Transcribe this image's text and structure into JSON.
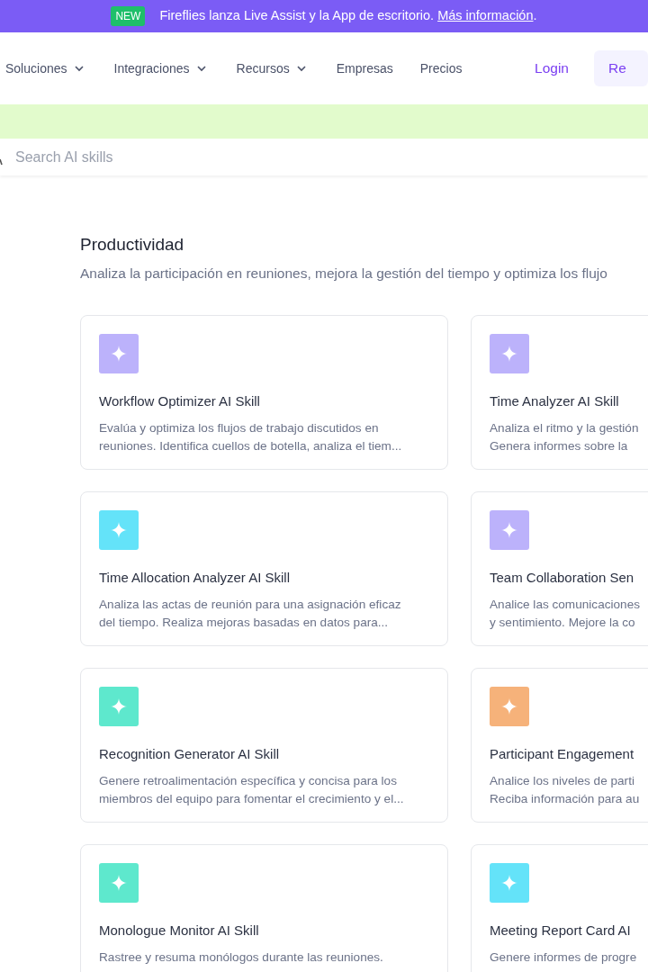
{
  "announcement": {
    "badge": "NEW",
    "text": "Fireflies lanza Live Assist y la App de escritorio.",
    "link": "Más información",
    "after": "."
  },
  "nav": {
    "items": [
      {
        "label": "Soluciones",
        "dropdown": true
      },
      {
        "label": "Integraciones",
        "dropdown": true
      },
      {
        "label": "Recursos",
        "dropdown": true
      },
      {
        "label": "Empresas",
        "dropdown": false
      },
      {
        "label": "Precios",
        "dropdown": false
      }
    ],
    "login": "Login",
    "register": "Re"
  },
  "search": {
    "placeholder": "Search AI skills"
  },
  "section": {
    "title": "Productividad",
    "subtitle": "Analiza la participación en reuniones, mejora la gestión del tiempo y optimiza los flujo",
    "cards": [
      {
        "title": "Workflow Optimizer AI Skill",
        "color": "#bcb2fb",
        "description_lines": [
          "Evalúa y optimiza los flujos de trabajo discutidos en",
          "reuniones. Identifica cuellos de botella, analiza el tiem..."
        ]
      },
      {
        "title": "Time Analyzer AI Skill",
        "color": "#bcb2fb",
        "description_lines": [
          "Analiza el ritmo y la gestión",
          "Genera informes sobre la"
        ]
      },
      {
        "title": "Time Allocation Analyzer AI Skill",
        "color": "#64e3f9",
        "description_lines": [
          "Analiza las actas de reunión para una asignación eficaz",
          "del tiempo. Realiza mejoras basadas en datos para..."
        ]
      },
      {
        "title": "Team Collaboration Sen",
        "color": "#bcb2fb",
        "description_lines": [
          "Analice las comunicaciones",
          "y sentimiento. Mejore la co"
        ]
      },
      {
        "title": "Recognition Generator AI Skill",
        "color": "#5ee8cd",
        "description_lines": [
          "Genere retroalimentación específica y concisa para los",
          "miembros del equipo para fomentar el crecimiento y el..."
        ]
      },
      {
        "title": "Participant Engagement",
        "color": "#f6b27a",
        "description_lines": [
          "Analice los niveles de parti",
          "Reciba información para au"
        ]
      },
      {
        "title": "Monologue Monitor AI Skill",
        "color": "#5ee8cd",
        "description_lines": [
          "Rastree y resuma monólogos durante las reuniones."
        ]
      },
      {
        "title": "Meeting Report Card AI",
        "color": "#64e3f9",
        "description_lines": [
          "Genere informes de progre"
        ]
      }
    ]
  }
}
